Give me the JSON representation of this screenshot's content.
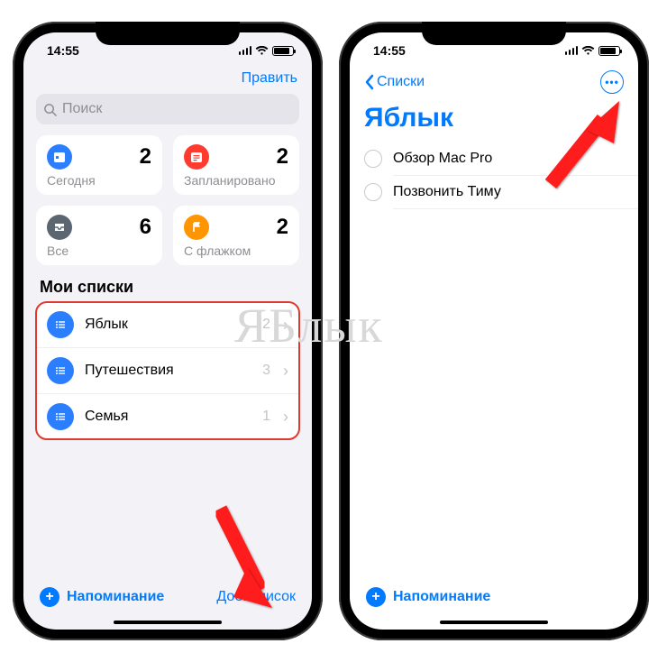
{
  "status": {
    "time": "14:55"
  },
  "left": {
    "edit": "Править",
    "search_placeholder": "Поиск",
    "cards": {
      "today": {
        "label": "Сегодня",
        "count": "2",
        "color": "#2b7fff"
      },
      "scheduled": {
        "label": "Запланировано",
        "count": "2",
        "color": "#ff3b30"
      },
      "all": {
        "label": "Все",
        "count": "6",
        "color": "#5b6670"
      },
      "flagged": {
        "label": "С флажком",
        "count": "2",
        "color": "#ff9500"
      }
    },
    "my_lists_header": "Мои списки",
    "lists": [
      {
        "name": "Яблык",
        "count": "2"
      },
      {
        "name": "Путешествия",
        "count": "3"
      },
      {
        "name": "Семья",
        "count": "1"
      }
    ],
    "add_reminder": "Напоминание",
    "add_list": "Доб. список"
  },
  "right": {
    "back": "Списки",
    "title": "Яблык",
    "reminders": [
      {
        "text": "Обзор Mac Pro"
      },
      {
        "text": "Позвонить Тиму"
      }
    ],
    "add_reminder": "Напоминание"
  },
  "watermark": "ЯБлык"
}
